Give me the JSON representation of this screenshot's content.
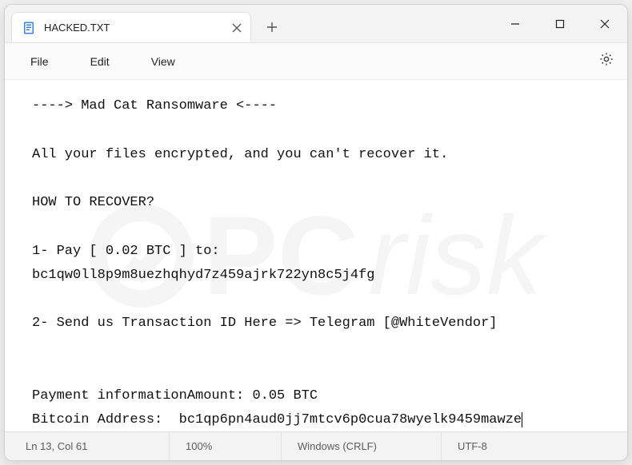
{
  "titlebar": {
    "tab_title": "HACKED.TXT"
  },
  "menubar": {
    "file": "File",
    "edit": "Edit",
    "view": "View"
  },
  "content": {
    "line1": "----> Mad Cat Ransomware <----",
    "line2": "",
    "line3": "All your files encrypted, and you can't recover it.",
    "line4": "",
    "line5": "HOW TO RECOVER?",
    "line6": "",
    "line7": "1- Pay [ 0.02 BTC ] to:",
    "line8": "bc1qw0ll8p9m8uezhqhyd7z459ajrk722yn8c5j4fg",
    "line9": "",
    "line10": "2- Send us Transaction ID Here => Telegram [@WhiteVendor]",
    "line11": "",
    "line12": "",
    "line13": "Payment informationAmount: 0.05 BTC",
    "line14": "Bitcoin Address:  bc1qp6pn4aud0jj7mtcv6p0cua78wyelk9459mawze"
  },
  "watermark": {
    "text_pc": "PC",
    "text_risk": "risk"
  },
  "statusbar": {
    "position": "Ln 13, Col 61",
    "zoom": "100%",
    "line_ending": "Windows (CRLF)",
    "encoding": "UTF-8"
  }
}
